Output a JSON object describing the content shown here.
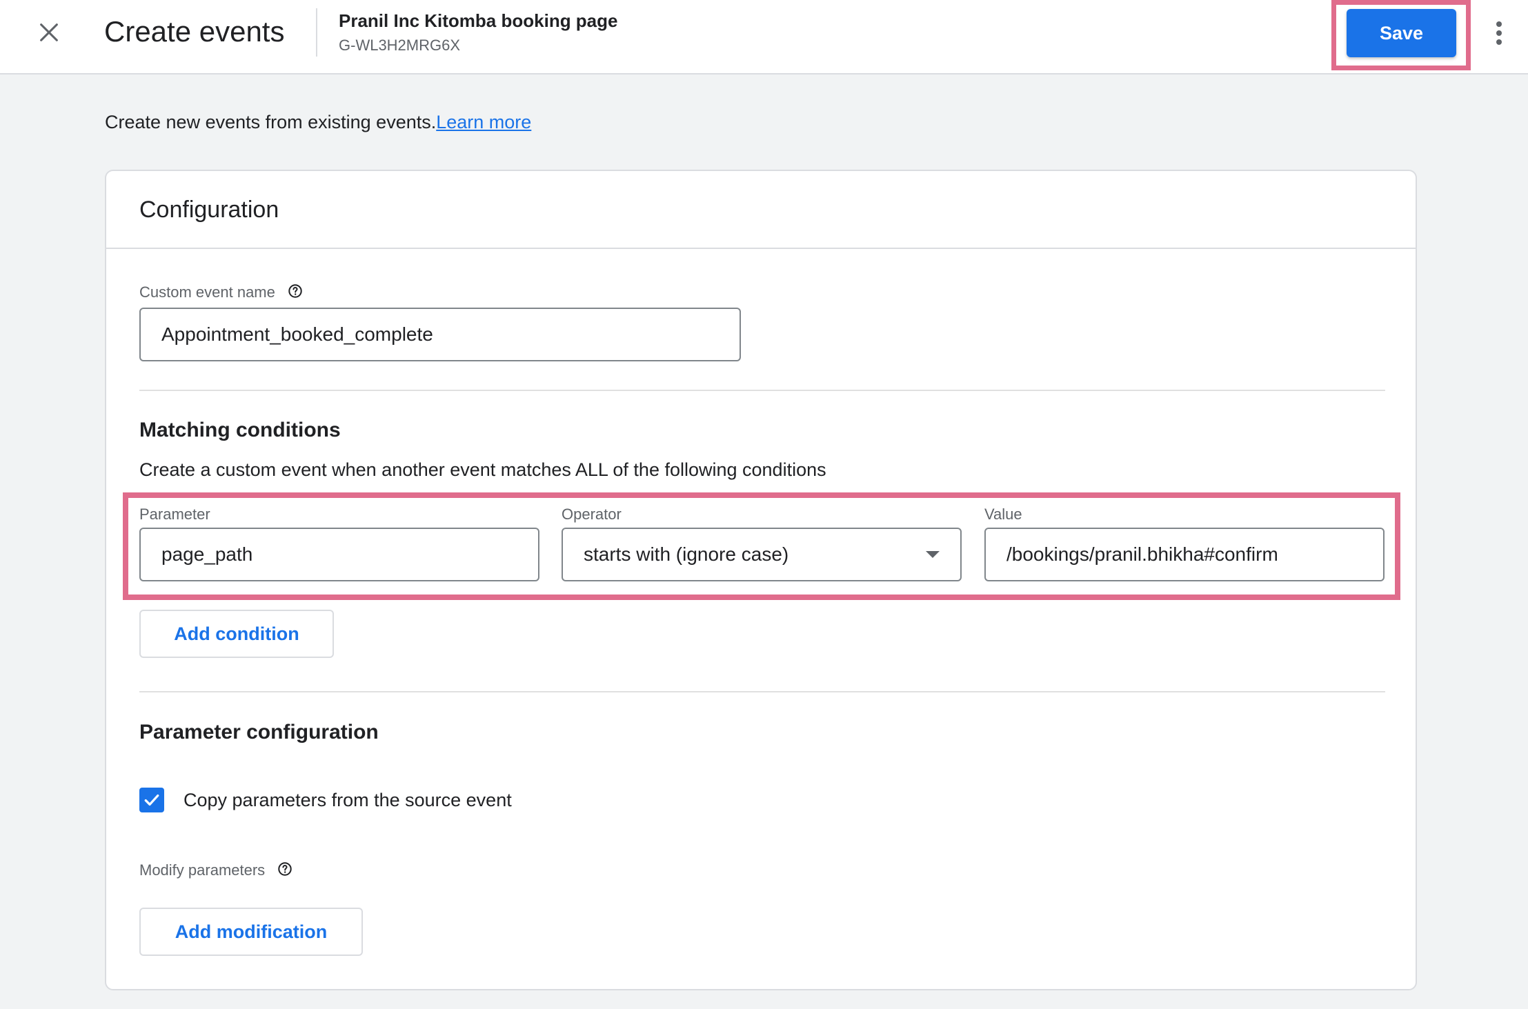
{
  "header": {
    "title": "Create events",
    "property_name": "Pranil Inc Kitomba booking page",
    "property_id": "G-WL3H2MRG6X",
    "save_label": "Save"
  },
  "intro": {
    "text": "Create new events from existing events.",
    "link_text": "Learn more"
  },
  "configuration": {
    "title": "Configuration",
    "custom_event_name": {
      "label": "Custom event name",
      "value": "Appointment_booked_complete"
    }
  },
  "matching_conditions": {
    "title": "Matching conditions",
    "description": "Create a custom event when another event matches ALL of the following conditions",
    "condition": {
      "parameter_label": "Parameter",
      "parameter_value": "page_path",
      "operator_label": "Operator",
      "operator_value": "starts with (ignore case)",
      "value_label": "Value",
      "value_value": "/bookings/pranil.bhikha#confirm"
    },
    "add_condition_label": "Add condition"
  },
  "parameter_configuration": {
    "title": "Parameter configuration",
    "copy_params_label": "Copy parameters from the source event",
    "copy_params_checked": true,
    "modify_label": "Modify parameters",
    "add_modification_label": "Add modification"
  },
  "icons": {
    "close": "close-icon",
    "more": "more-vert-icon",
    "help": "help-circle-icon",
    "dropdown": "arrow-drop-down-icon",
    "check": "check-icon"
  },
  "colors": {
    "primary": "#1a73e8",
    "highlight": "#e06c8c",
    "background": "#f1f3f4"
  }
}
